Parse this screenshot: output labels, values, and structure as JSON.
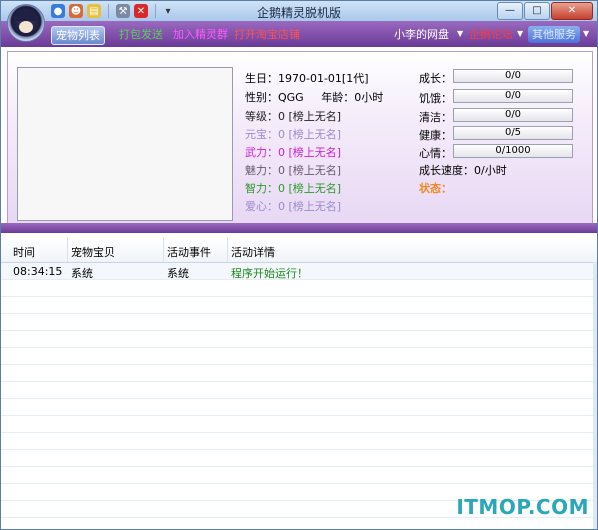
{
  "window": {
    "title": "企鹅精灵脱机版",
    "minimize": "—",
    "maximize": "□",
    "close": "✕"
  },
  "toolbar_icons": [
    "globe-icon",
    "people-icon",
    "notepad-icon",
    "tools-icon",
    "close-red-icon"
  ],
  "tabs": {
    "active": "宠物列表",
    "send": "打包发送",
    "join": "加入精灵群",
    "shop": "打开淘宝店铺",
    "netdisk": "小李的网盘",
    "qq": "企鹅论坛",
    "more": "其他服务"
  },
  "pet": {
    "birthday_label": "生日：",
    "birthday": "1970-01-01[1代]",
    "gender_label": "性别：",
    "gender": "QGG",
    "age_label": "年龄：",
    "age": "0小时",
    "level": "等级：0 [榜上无名]",
    "yuanbao": "元宝：0 [榜上无名]",
    "wuli": "武力：0 [榜上无名]",
    "meili": "魅力：0 [榜上无名]",
    "zhili": "智力：0 [榜上无名]",
    "aixin": "爱心：0 [榜上无名]"
  },
  "stats": {
    "growth_label": "成长：",
    "growth": "0/0",
    "hunger_label": "饥饿：",
    "hunger": "0/0",
    "clean_label": "清洁：",
    "clean": "0/0",
    "health_label": "健康：",
    "health": "0/5",
    "mood_label": "心情：",
    "mood": "0/1000",
    "speed_label": "成长速度：",
    "speed": "0/小时",
    "status_label": "状态："
  },
  "log": {
    "headers": [
      "时间",
      "宠物宝贝",
      "活动事件",
      "活动详情"
    ],
    "rows": [
      {
        "time": "08:34:15",
        "pet": "系统",
        "event": "系统",
        "detail": "程序开始运行！"
      }
    ]
  },
  "watermark": "ITMOP.COM",
  "colors": {
    "purple": "#7a4aa8",
    "accent_green": "#2a9a2a"
  }
}
